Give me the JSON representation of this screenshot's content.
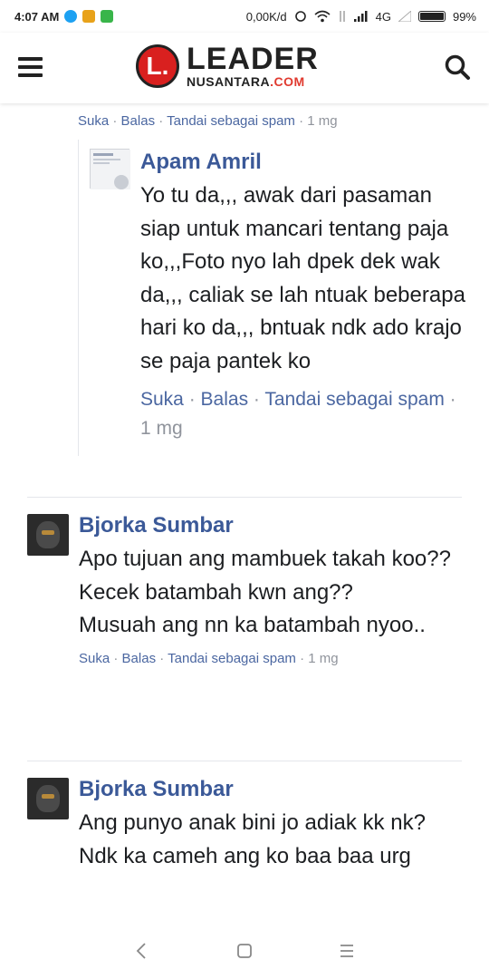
{
  "status_bar": {
    "time": "4:07 AM",
    "network_speed": "0,00K/d",
    "network_type": "4G",
    "battery": "99%",
    "app_colors": [
      "#1da1f2",
      "#e8a21a",
      "#39b54a"
    ]
  },
  "header": {
    "logo_letter": "L.",
    "logo_main": "LEADER",
    "logo_sub_prefix": "NUSANTARA",
    "logo_sub_suffix": ".COM",
    "brand_color": "#d9201f"
  },
  "top_actions": {
    "like": "Suka",
    "reply": "Balas",
    "spam": "Tandai sebagai spam",
    "time": "1 mg"
  },
  "reply": {
    "author": "Apam Amril",
    "text": "Yo tu da,,, awak dari pasaman siap untuk mancari tentang paja ko,,,Foto nyo lah dpek dek wak da,,, caliak se lah ntuak beberapa hari ko da,,, bntuak ndk ado krajo se paja pantek ko",
    "like": "Suka",
    "reply_label": "Balas",
    "spam": "Tandai sebagai spam",
    "time": "1 mg"
  },
  "comments": [
    {
      "author": "Bjorka Sumbar",
      "lines": [
        "Apo tujuan ang mambuek takah koo??",
        "Kecek batambah kwn ang??",
        "Musuah ang nn ka batambah nyoo.."
      ],
      "like": "Suka",
      "reply_label": "Balas",
      "spam": "Tandai sebagai spam",
      "time": "1 mg"
    },
    {
      "author": "Bjorka Sumbar",
      "lines": [
        "Ang punyo anak bini jo adiak kk nk?",
        "Ndk ka cameh ang ko baa baa urg"
      ]
    }
  ],
  "colors": {
    "link": "#4b67a1",
    "author": "#3b5998",
    "muted": "#90949c"
  },
  "icons": {
    "menu": "hamburger-icon",
    "search": "search-icon",
    "back": "back-icon",
    "home": "home-icon",
    "recents": "recents-icon"
  }
}
